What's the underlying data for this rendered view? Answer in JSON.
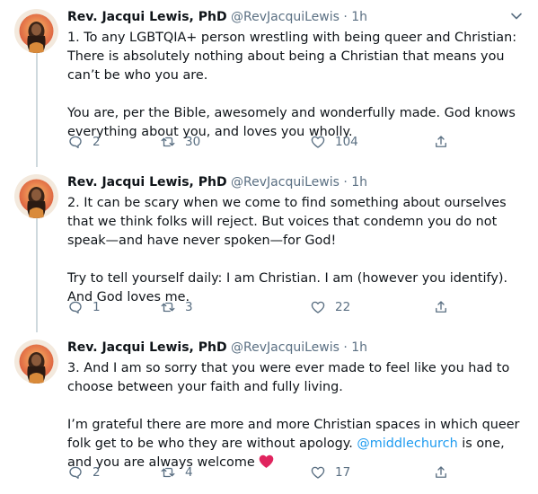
{
  "tweets": [
    {
      "name": "Rev. Jacqui Lewis, PhD",
      "handle": "@RevJacquiLewis",
      "dot": "·",
      "time": "1h",
      "paragraphs": [
        "1. To any LGBTQIA+ person wrestling with being queer and Christian: There is absolutely nothing about being a Christian that means you can’t be who you are.",
        "You are, per the Bible, awesomely and wonderfully made. God knows everything about you, and loves you wholly."
      ],
      "replies": "2",
      "retweets": "30",
      "likes": "104"
    },
    {
      "name": "Rev. Jacqui Lewis, PhD",
      "handle": "@RevJacquiLewis",
      "dot": "·",
      "time": "1h",
      "paragraphs": [
        "2. It can be scary when we come to find something about ourselves that we think folks will reject. But voices that condemn you do not speak—and have never spoken—for God!",
        "Try to tell yourself daily: I am Christian. I am (however you identify). And God loves me."
      ],
      "replies": "1",
      "retweets": "3",
      "likes": "22"
    },
    {
      "name": "Rev. Jacqui Lewis, PhD",
      "handle": "@RevJacquiLewis",
      "dot": "·",
      "time": "1h",
      "paragraphs": [
        "3. And I am so sorry that you were ever made to feel like you had to choose between your faith and fully living."
      ],
      "p2_before": "I’m grateful there are more and more Christian spaces in which queer folk get to be who they are without apology. ",
      "p2_mention": "@middlechurch",
      "p2_after": " is one, and you are always welcome ",
      "replies": "2",
      "retweets": "4",
      "likes": "17"
    }
  ],
  "icons": {
    "reply": "reply-icon",
    "retweet": "retweet-icon",
    "like": "like-icon",
    "share": "share-icon",
    "more": "chevron-down-icon",
    "heart_emoji": "red-heart-emoji"
  },
  "colors": {
    "accent": "#1d9bf0",
    "muted": "#5b7083",
    "thread_line": "#cfd9de",
    "heart": "#e0245e"
  }
}
